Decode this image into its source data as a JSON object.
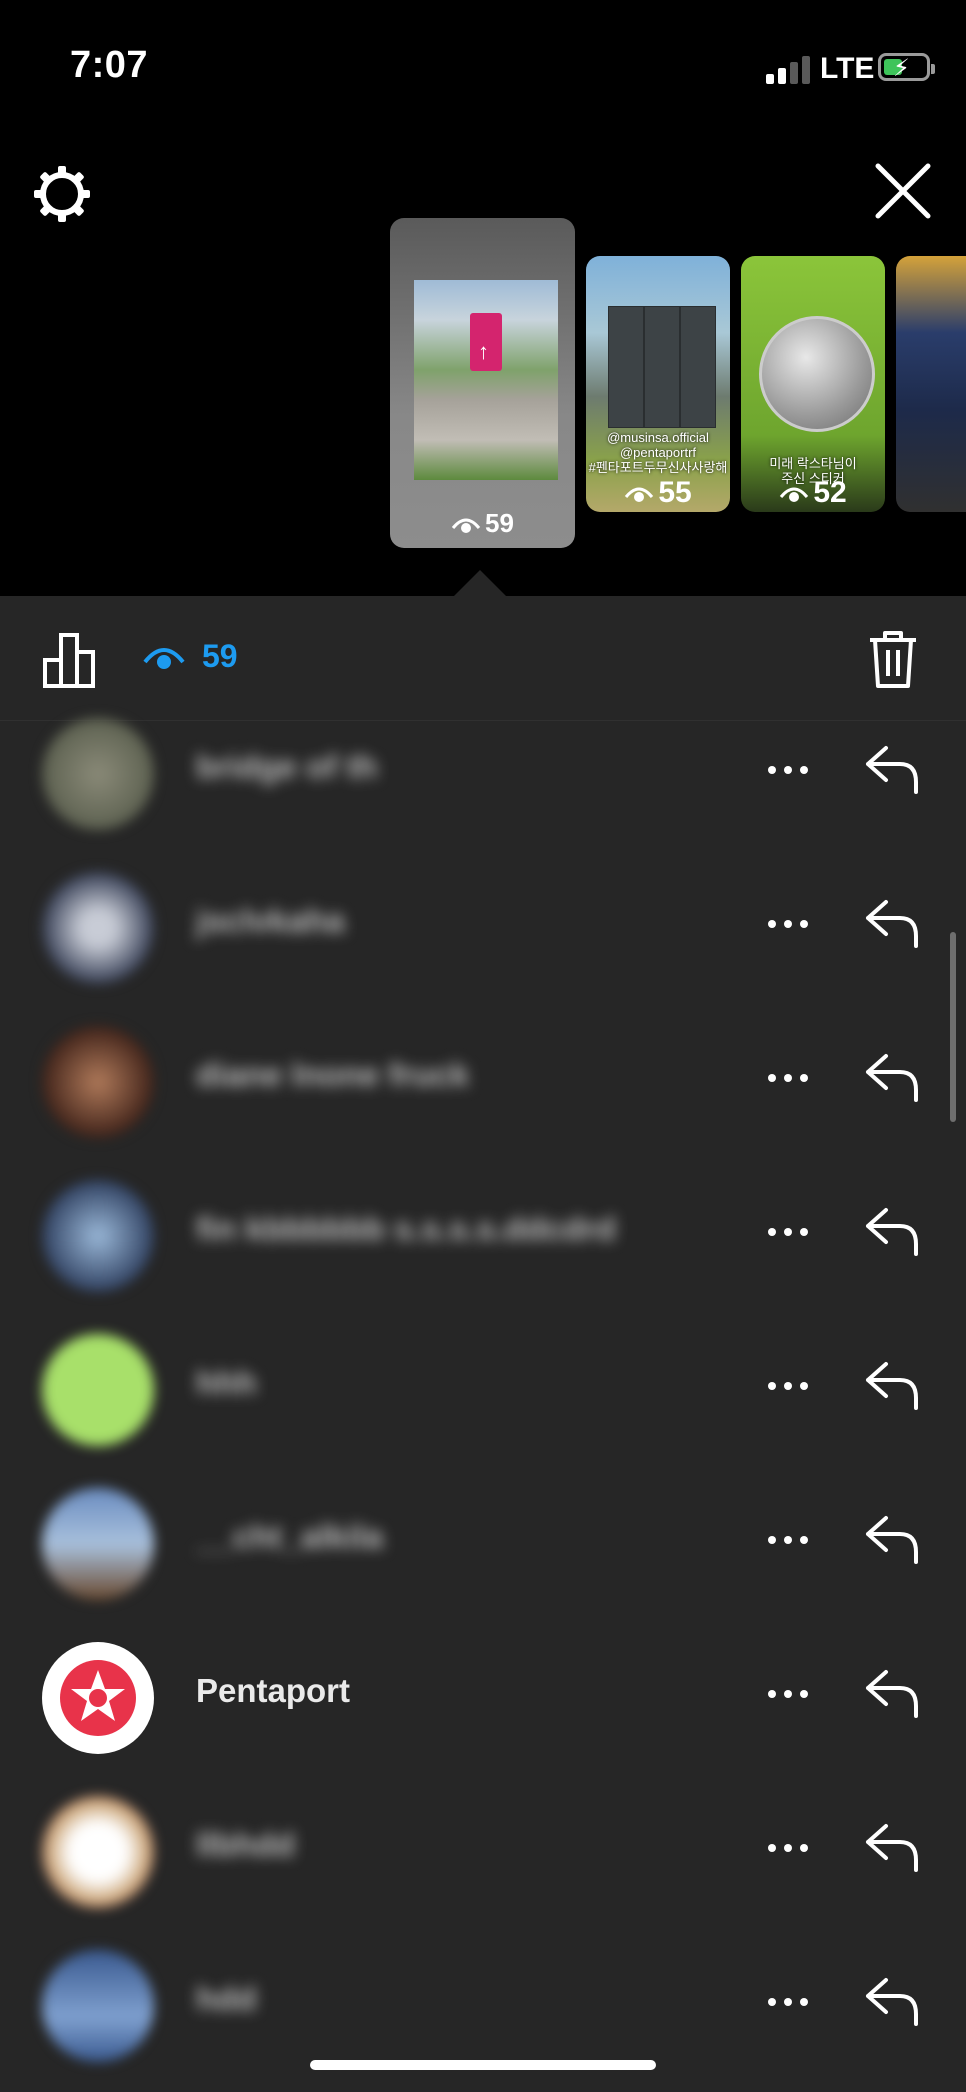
{
  "status_bar": {
    "time": "7:07",
    "network": "LTE"
  },
  "stories": [
    {
      "views": "59",
      "active": true
    },
    {
      "views": "55",
      "caption": "@musinsa.official\n@pentaportrf\n#펜타포트두무신사사랑해"
    },
    {
      "views": "52",
      "caption": "미래 락스타님이\n주신 스티커"
    },
    {
      "views": ""
    }
  ],
  "toolbar": {
    "view_count": "59"
  },
  "viewers": [
    {
      "name": "bridge of th",
      "blurred": true,
      "avatar_color": "#6a6f5a"
    },
    {
      "name": "jsclvkaha",
      "blurred": true,
      "avatar_color": "#5b6373"
    },
    {
      "name": "diane lnone fruck",
      "blurred": true,
      "avatar_color": "#6b3a2c"
    },
    {
      "name": "fin kbbbbbb s.s.s.s.ddcdrd",
      "blurred": true,
      "avatar_color": "#4a6a90"
    },
    {
      "name": "hhh",
      "blurred": true,
      "avatar_color": "#a8e06a"
    },
    {
      "name": "__cht_alkila",
      "blurred": true,
      "avatar_color": "#6a88b0"
    },
    {
      "name": "Pentaport",
      "blurred": false,
      "avatar_color": "#ffffff"
    },
    {
      "name": "llbhdd",
      "blurred": true,
      "avatar_color": "#e8e0d8"
    },
    {
      "name": "hdd",
      "blurred": true,
      "avatar_color": "#5b80b5"
    }
  ],
  "colors": {
    "accent": "#1d9bf0",
    "panel": "#262626",
    "pentaport_red": "#e8334a"
  }
}
